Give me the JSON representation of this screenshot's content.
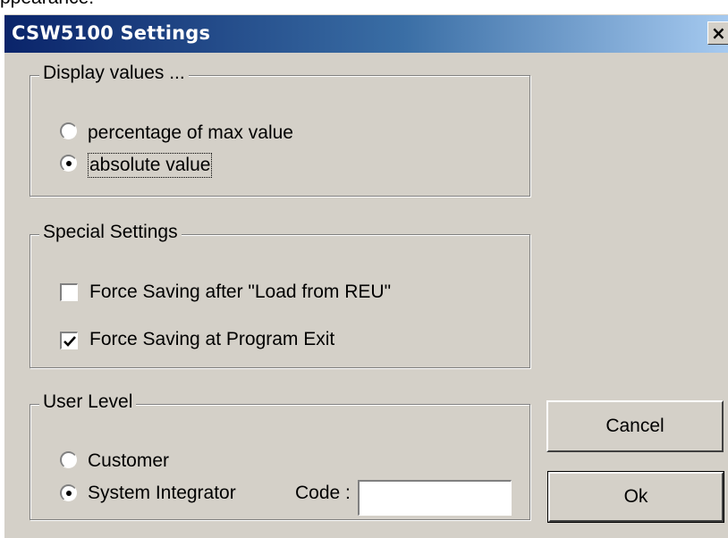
{
  "background_text": "ppearance.",
  "dialog": {
    "title": "CSW5100 Settings",
    "close_glyph": "×"
  },
  "display_values": {
    "legend": "Display values ...",
    "options": [
      {
        "label": "percentage of max value",
        "selected": false
      },
      {
        "label": "absolute value",
        "selected": true
      }
    ]
  },
  "special_settings": {
    "legend": "Special Settings",
    "options": [
      {
        "label": "Force Saving after \"Load from REU\"",
        "checked": false
      },
      {
        "label": "Force Saving at Program Exit",
        "checked": true
      }
    ]
  },
  "user_level": {
    "legend": "User Level",
    "options": [
      {
        "label": "Customer",
        "selected": false
      },
      {
        "label": "System Integrator",
        "selected": true
      }
    ],
    "code_label": "Code :",
    "code_value": ""
  },
  "buttons": {
    "cancel": "Cancel",
    "ok": "Ok"
  },
  "colors": {
    "dialog_face": "#d4d0c8",
    "title_start": "#0a246a",
    "title_end": "#a6caf0"
  }
}
